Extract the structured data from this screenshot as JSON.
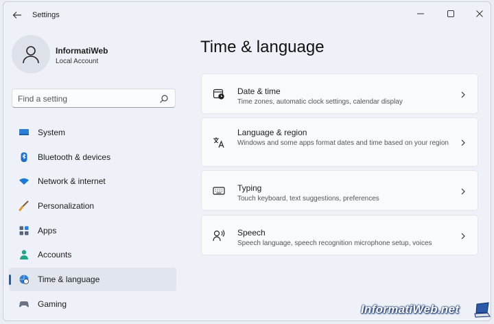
{
  "titlebar": {
    "app_title": "Settings",
    "icons": {
      "back": "back-arrow-icon",
      "minimize": "minimize-icon",
      "maximize": "maximize-icon",
      "close": "close-icon"
    }
  },
  "profile": {
    "name": "InformatiWeb",
    "account_type": "Local Account",
    "avatar_icon": "user-avatar-icon"
  },
  "search": {
    "placeholder": "Find a setting",
    "value": "",
    "icon": "search-icon"
  },
  "sidebar": {
    "items": [
      {
        "label": "System",
        "icon": "monitor-icon",
        "active": false
      },
      {
        "label": "Bluetooth & devices",
        "icon": "bluetooth-icon",
        "active": false
      },
      {
        "label": "Network & internet",
        "icon": "wifi-icon",
        "active": false
      },
      {
        "label": "Personalization",
        "icon": "paintbrush-icon",
        "active": false
      },
      {
        "label": "Apps",
        "icon": "apps-icon",
        "active": false
      },
      {
        "label": "Accounts",
        "icon": "person-icon",
        "active": false
      },
      {
        "label": "Time & language",
        "icon": "globe-clock-icon",
        "active": true
      },
      {
        "label": "Gaming",
        "icon": "gamepad-icon",
        "active": false
      }
    ]
  },
  "main": {
    "title": "Time & language",
    "cards": [
      {
        "title": "Date & time",
        "description": "Time zones, automatic clock settings, calendar display",
        "icon": "calendar-clock-icon"
      },
      {
        "title": "Language & region",
        "description": "Windows and some apps format dates and time based on your region",
        "icon": "language-icon"
      },
      {
        "title": "Typing",
        "description": "Touch keyboard, text suggestions, preferences",
        "icon": "keyboard-icon"
      },
      {
        "title": "Speech",
        "description": "Speech language, speech recognition microphone setup, voices",
        "icon": "speech-icon"
      }
    ]
  },
  "watermark": {
    "text": "InformatiWeb.net",
    "logo_icon": "laptop-logo-icon"
  },
  "colors": {
    "accent": "#1a5fb4",
    "window_bg": "#eef1f7",
    "card_bg": "#f9fafc"
  }
}
